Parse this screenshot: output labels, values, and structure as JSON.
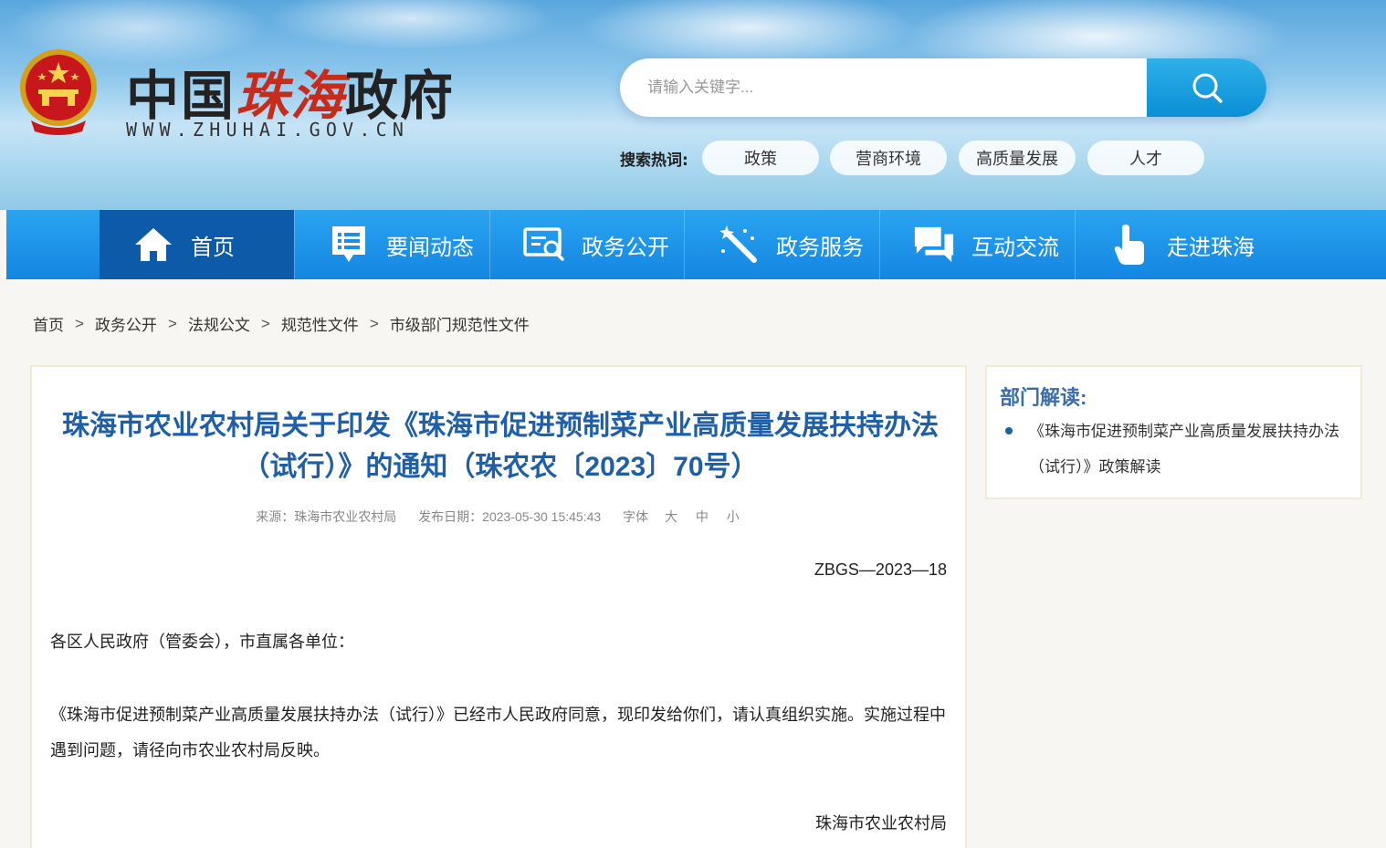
{
  "header": {
    "logo_text_a": "中国",
    "logo_text_b": "珠海",
    "logo_text_c": "政府",
    "logo_url": "WWW.ZHUHAI.GOV.CN",
    "search": {
      "placeholder": "请输入关键字..."
    },
    "hot_label": "搜索热词:",
    "hot_tags": [
      "政策",
      "营商环境",
      "高质量发展",
      "人才"
    ]
  },
  "nav": {
    "items": [
      {
        "label": "首页",
        "icon": "home-icon"
      },
      {
        "label": "要闻动态",
        "icon": "news-icon"
      },
      {
        "label": "政务公开",
        "icon": "open-gov-icon"
      },
      {
        "label": "政务服务",
        "icon": "service-icon"
      },
      {
        "label": "互动交流",
        "icon": "chat-icon"
      },
      {
        "label": "走进珠海",
        "icon": "hand-pointer-icon"
      }
    ]
  },
  "breadcrumb": {
    "items": [
      "首页",
      "政务公开",
      "法规公文",
      "规范性文件",
      "市级部门规范性文件"
    ],
    "separator": ">"
  },
  "article": {
    "title": "珠海市农业农村局关于印发《珠海市促进预制菜产业高质量发展扶持办法（试行）》的通知（珠农农〔2023〕70号）",
    "source_label": "来源：",
    "source_value": "珠海市农业农村局",
    "date_label": "发布日期：",
    "date_value": "2023-05-30 15:45:43",
    "font_label": "字体",
    "font_sizes": [
      "大",
      "中",
      "小"
    ],
    "doc_number": "ZBGS—2023—18",
    "salutation": "各区人民政府（管委会），市直属各单位：",
    "body": "《珠海市促进预制菜产业高质量发展扶持办法（试行）》已经市人民政府同意，现印发给你们，请认真组织实施。实施过程中遇到问题，请径向市农业农村局反映。",
    "signer": "珠海市农业农村局"
  },
  "side": {
    "title": "部门解读:",
    "items": [
      "《珠海市促进预制菜产业高质量发展扶持办法（试行）》政策解读"
    ]
  },
  "colors": {
    "nav_bg": "#1486e2",
    "nav_active": "#0d5aa8",
    "title_blue": "#1f5fa8",
    "search_btn": "#0a8fd6",
    "logo_red": "#c62b1c"
  }
}
